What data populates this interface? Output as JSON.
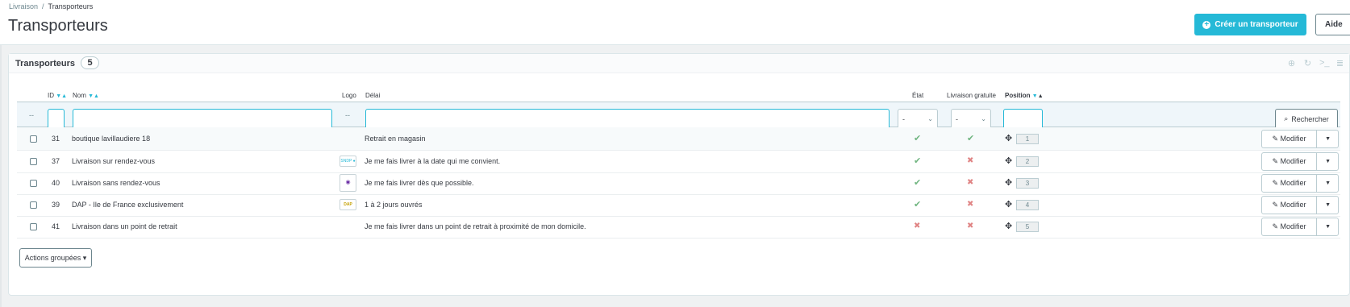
{
  "breadcrumb": {
    "parent": "Livraison",
    "current": "Transporteurs"
  },
  "page_title": "Transporteurs",
  "toolbar": {
    "create_label": "Créer un transporteur",
    "help_label": "Aide"
  },
  "panel": {
    "title": "Transporteurs",
    "count": "5",
    "tool_icons": [
      "add-icon",
      "refresh-icon",
      "sql-terminal-icon",
      "database-icon"
    ]
  },
  "columns": {
    "id": "ID",
    "name": "Nom",
    "logo": "Logo",
    "delay": "Délai",
    "state": "État",
    "free_shipping": "Livraison gratuite",
    "position": "Position"
  },
  "filters": {
    "bulk_placeholder": "--",
    "logo_placeholder": "--",
    "state_value": "-",
    "free_value": "-",
    "search_label": "Rechercher"
  },
  "rows": [
    {
      "id": "31",
      "name": "boutique lavillaudiere 18",
      "logo": "",
      "delay": "Retrait en magasin",
      "state": "✔",
      "free": "✔",
      "position": "1"
    },
    {
      "id": "37",
      "name": "Livraison sur rendez-vous",
      "logo": "SNDP ●",
      "delay": "Je me fais livrer à la date qui me convient.",
      "state": "✔",
      "free": "✖",
      "position": "2"
    },
    {
      "id": "40",
      "name": "Livraison sans rendez-vous",
      "logo": "◉",
      "delay": "Je me fais livrer dès que possible.",
      "state": "✔",
      "free": "✖",
      "position": "3"
    },
    {
      "id": "39",
      "name": "DAP - Ile de France exclusivement",
      "logo": "DAP",
      "delay": "1 à 2 jours ouvrés",
      "state": "✔",
      "free": "✖",
      "position": "4"
    },
    {
      "id": "41",
      "name": "Livraison dans un point de retrait",
      "logo": "",
      "delay": "Je me fais livrer dans un point de retrait à proximité de mon domicile.",
      "state": "✖",
      "free": "✖",
      "position": "5"
    }
  ],
  "row_actions": {
    "modify_label": "Modifier"
  },
  "bulk_actions_label": "Actions groupées ▾",
  "colors": {
    "accent": "#25b9d7",
    "success": "#70b580",
    "danger": "#e08484"
  }
}
